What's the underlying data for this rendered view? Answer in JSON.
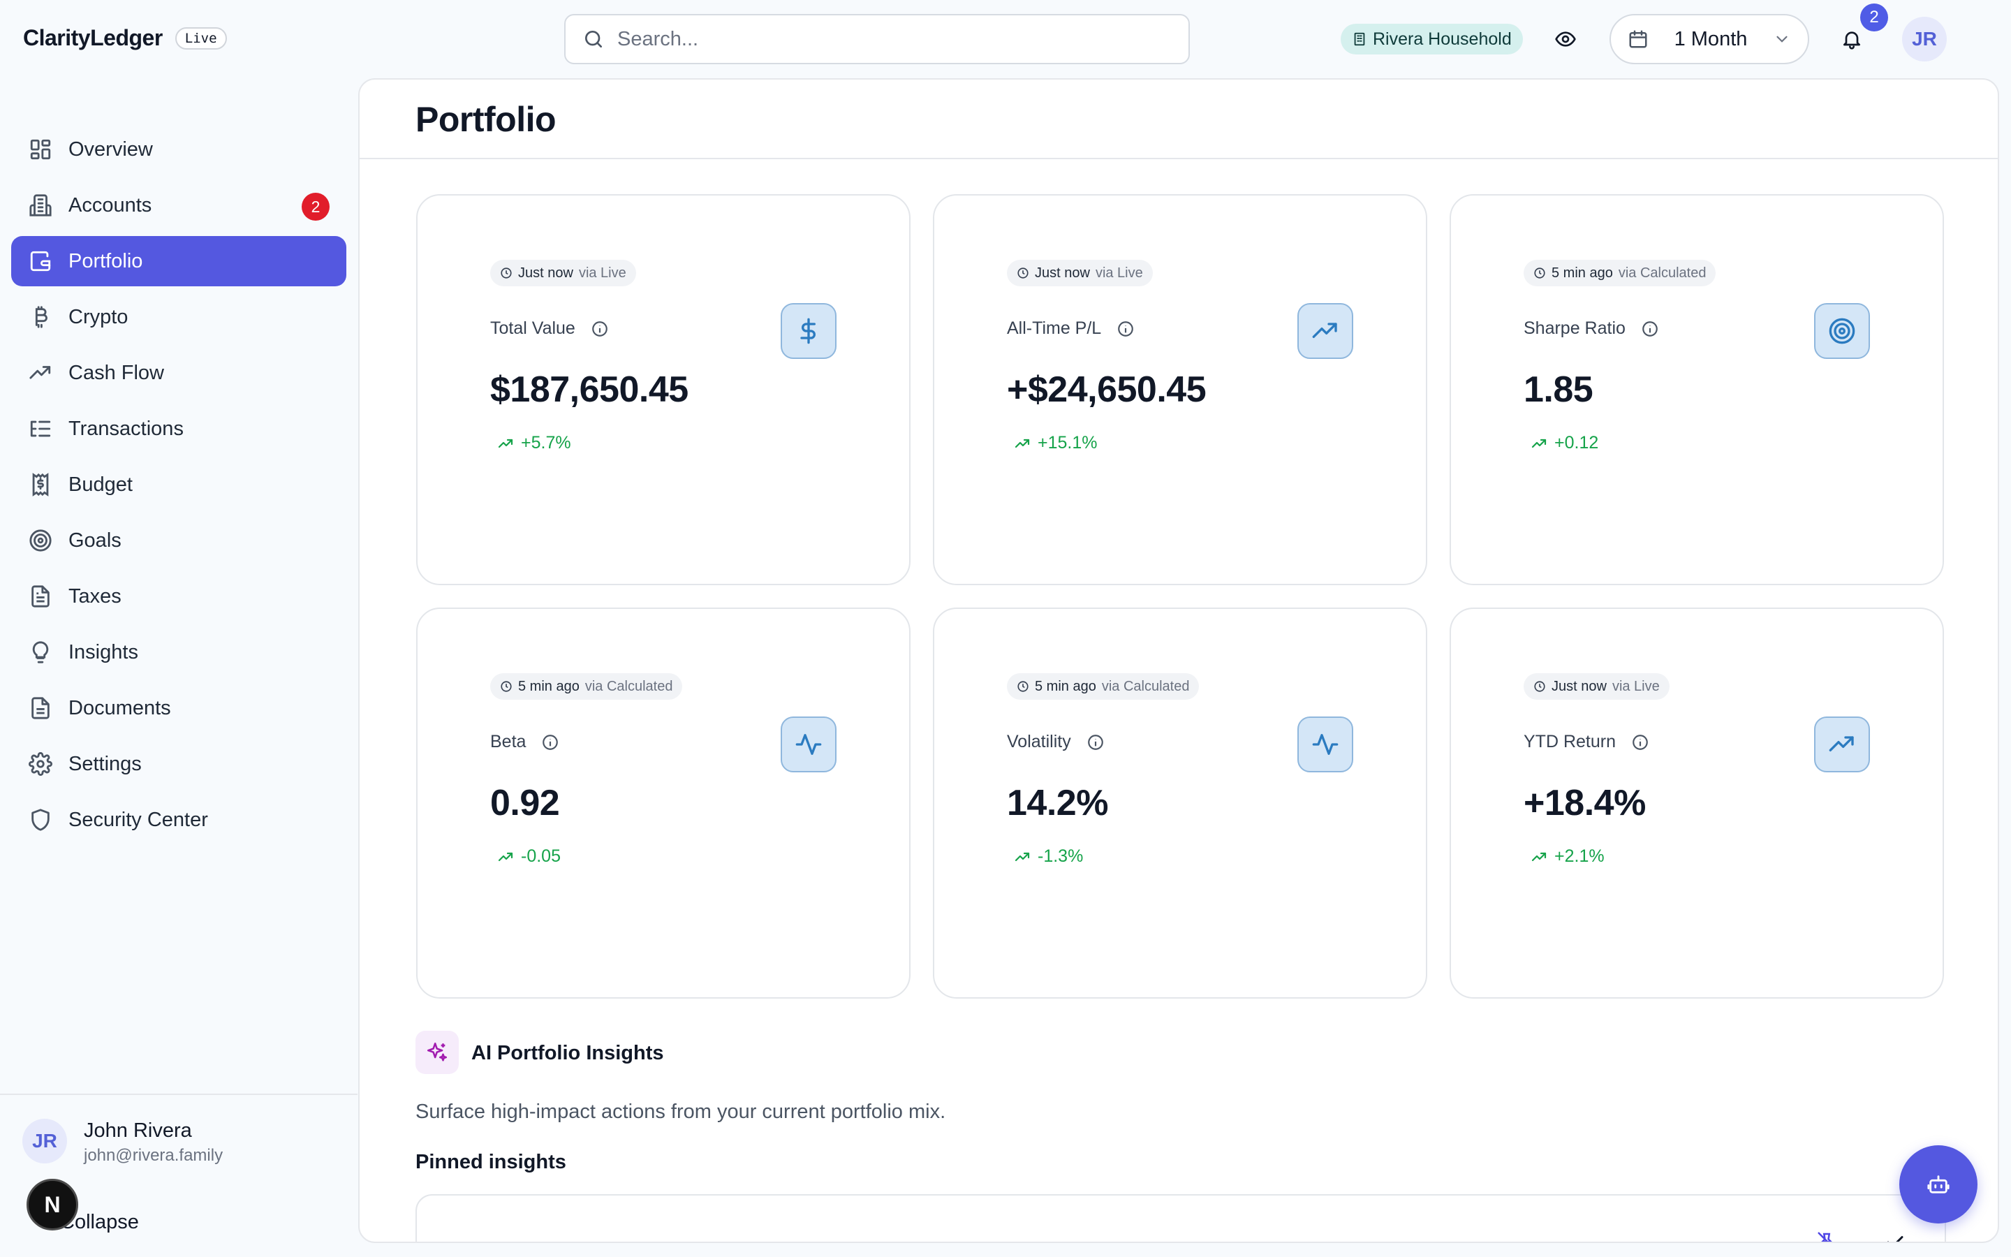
{
  "app": {
    "name": "ClarityLedger",
    "badge": "Live"
  },
  "header": {
    "search_placeholder": "Search...",
    "household": "Rivera Household",
    "period": "1 Month",
    "notification_count": "2",
    "avatar_initials": "JR"
  },
  "sidebar": {
    "items": [
      {
        "label": "Overview",
        "icon": "grid-icon"
      },
      {
        "label": "Accounts",
        "icon": "building-icon",
        "badge": "2"
      },
      {
        "label": "Portfolio",
        "icon": "wallet-icon",
        "active": true
      },
      {
        "label": "Crypto",
        "icon": "bitcoin-icon"
      },
      {
        "label": "Cash Flow",
        "icon": "trending-up-icon"
      },
      {
        "label": "Transactions",
        "icon": "list-icon"
      },
      {
        "label": "Budget",
        "icon": "receipt-icon"
      },
      {
        "label": "Goals",
        "icon": "target-icon"
      },
      {
        "label": "Taxes",
        "icon": "file-icon"
      },
      {
        "label": "Insights",
        "icon": "lightbulb-icon"
      },
      {
        "label": "Documents",
        "icon": "document-icon"
      },
      {
        "label": "Settings",
        "icon": "gear-icon"
      },
      {
        "label": "Security Center",
        "icon": "shield-icon"
      }
    ],
    "user": {
      "initials": "JR",
      "name": "John Rivera",
      "email": "john@rivera.family"
    },
    "collapse_label": "Collapse",
    "n_badge": "N"
  },
  "main": {
    "title": "Portfolio",
    "cards": [
      {
        "time": "Just now",
        "via": "via Live",
        "label": "Total Value",
        "value": "$187,650.45",
        "change": "+5.7%",
        "icon": "dollar-icon"
      },
      {
        "time": "Just now",
        "via": "via Live",
        "label": "All-Time P/L",
        "value": "+$24,650.45",
        "change": "+15.1%",
        "icon": "trending-up-icon"
      },
      {
        "time": "5 min ago",
        "via": "via Calculated",
        "label": "Sharpe Ratio",
        "value": "1.85",
        "change": "+0.12",
        "icon": "target-icon"
      },
      {
        "time": "5 min ago",
        "via": "via Calculated",
        "label": "Beta",
        "value": "0.92",
        "change": "-0.05",
        "icon": "activity-icon"
      },
      {
        "time": "5 min ago",
        "via": "via Calculated",
        "label": "Volatility",
        "value": "14.2%",
        "change": "-1.3%",
        "icon": "activity-icon"
      },
      {
        "time": "Just now",
        "via": "via Live",
        "label": "YTD Return",
        "value": "+18.4%",
        "change": "+2.1%",
        "icon": "trending-up-icon"
      }
    ],
    "ai": {
      "title": "AI Portfolio Insights",
      "subtitle": "Surface high-impact actions from your current portfolio mix.",
      "pinned_label": "Pinned insights"
    }
  },
  "colors": {
    "accent": "#5458e0",
    "positive": "#16a34a",
    "badge_red": "#e11d2a",
    "icon_blue": "#2b7bc0"
  }
}
